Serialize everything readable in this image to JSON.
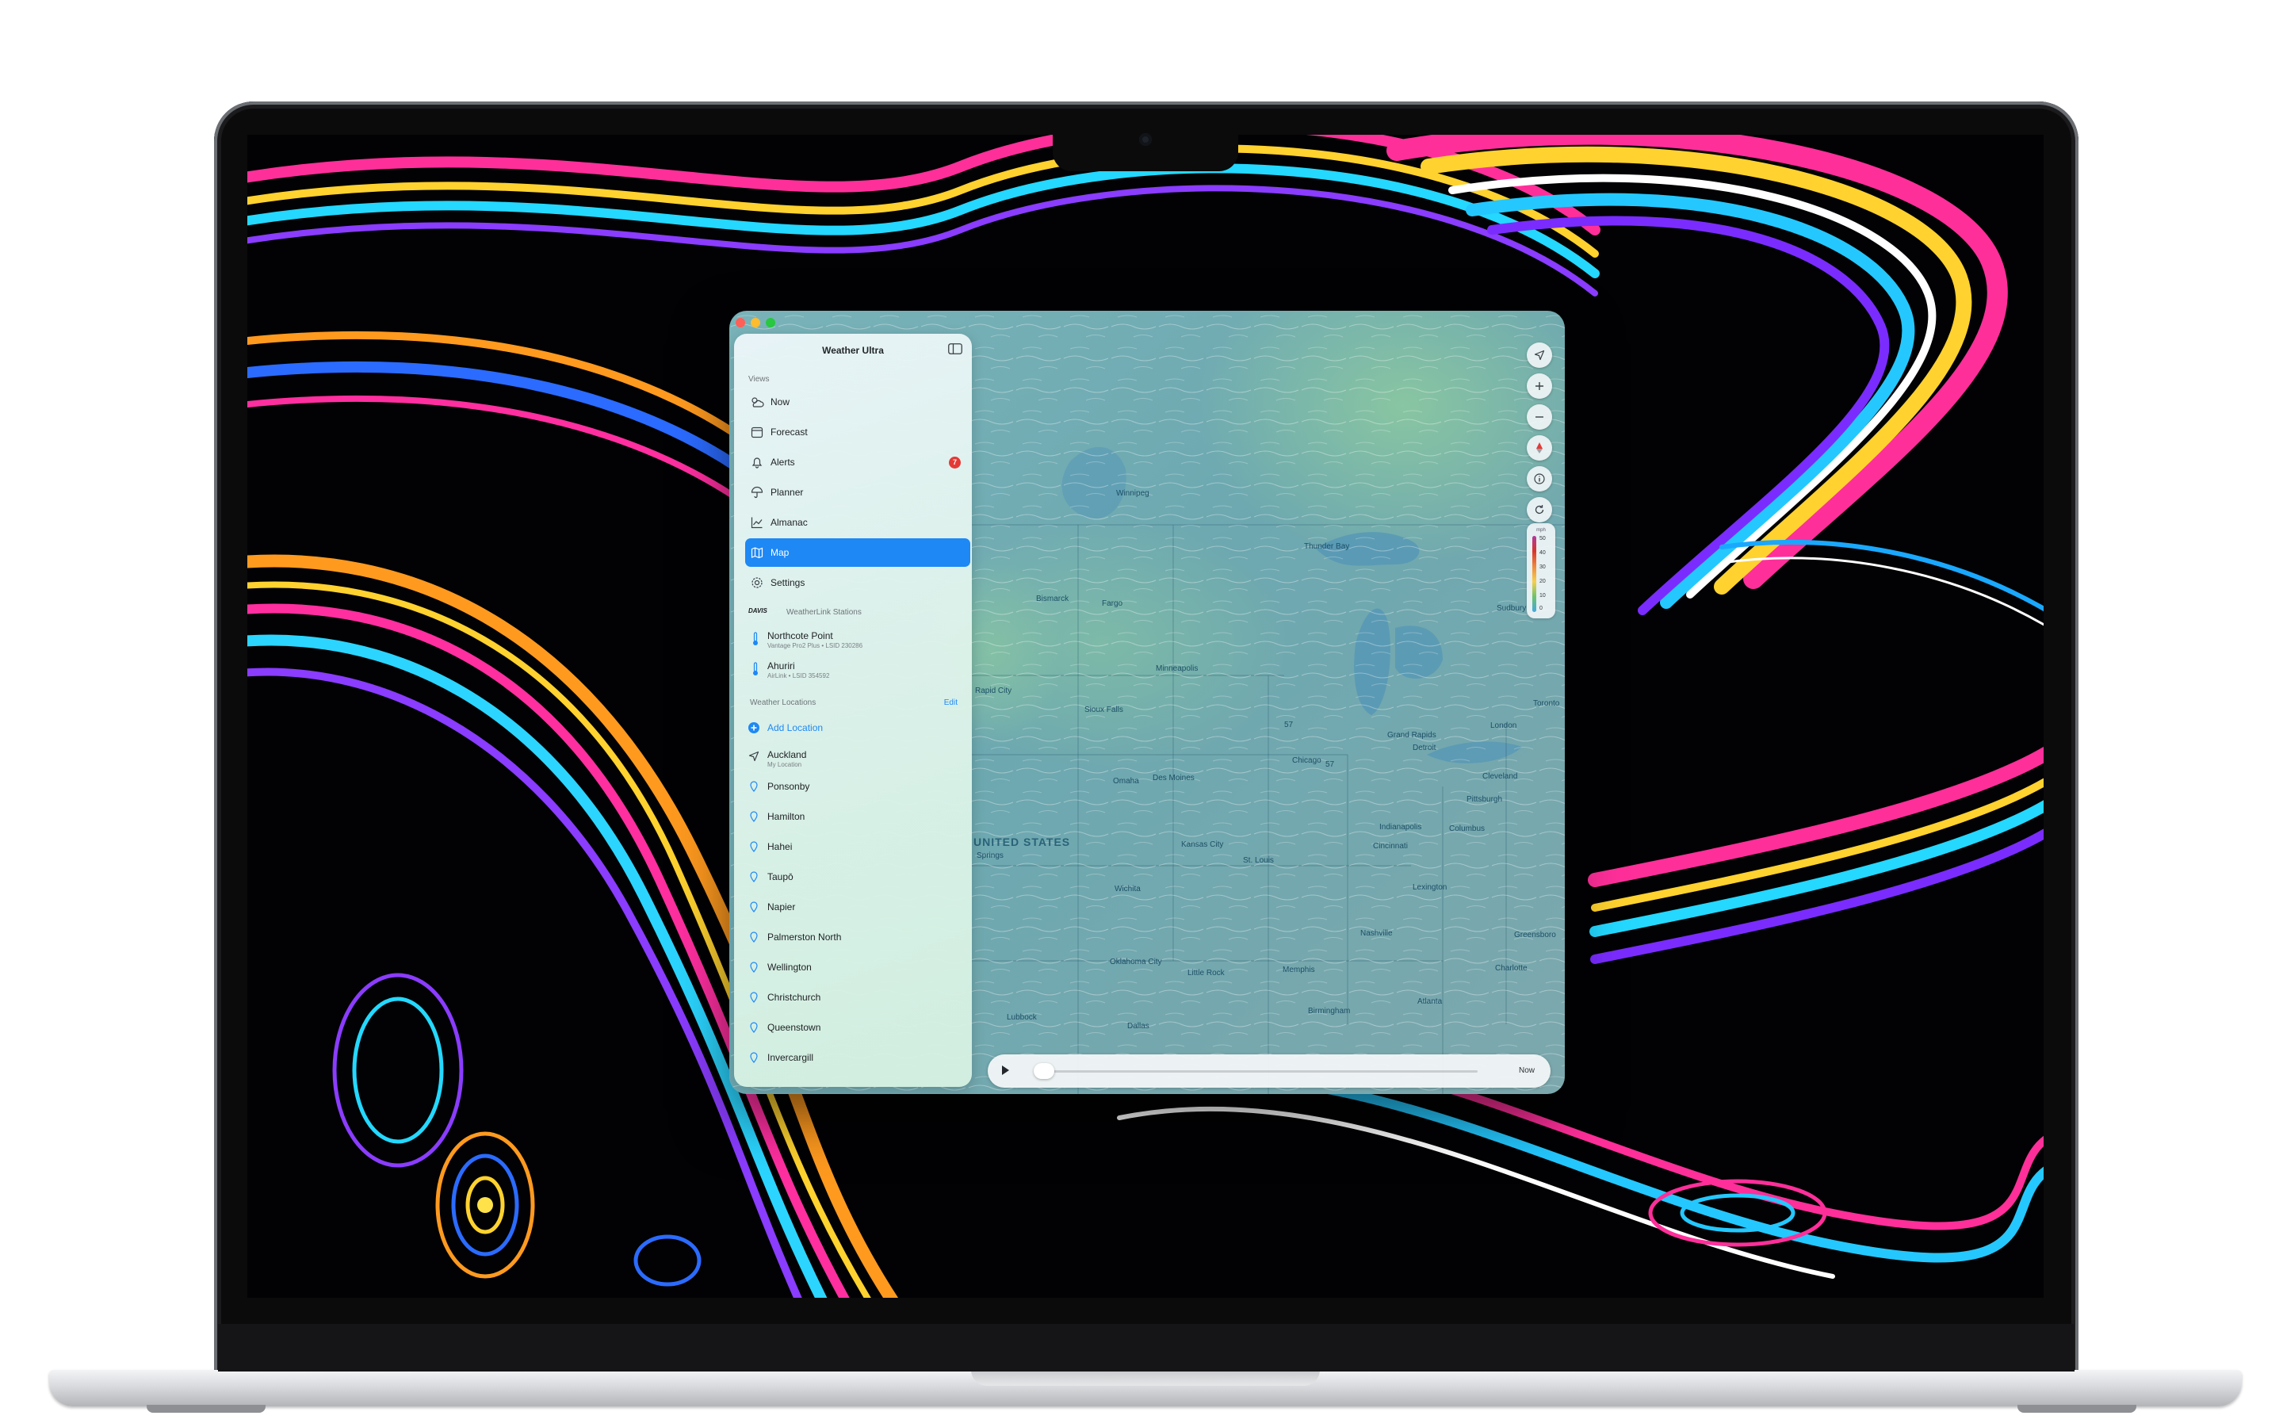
{
  "app": {
    "title": "Weather Ultra"
  },
  "sidebar": {
    "views_heading": "Views",
    "nav": [
      {
        "label": "Now",
        "icon": "sun-cloud-icon"
      },
      {
        "label": "Forecast",
        "icon": "calendar-icon"
      },
      {
        "label": "Alerts",
        "icon": "bell-icon",
        "badge": "7"
      },
      {
        "label": "Planner",
        "icon": "umbrella-icon"
      },
      {
        "label": "Almanac",
        "icon": "chart-icon"
      },
      {
        "label": "Map",
        "icon": "map-icon",
        "selected": true
      },
      {
        "label": "Settings",
        "icon": "gear-icon"
      }
    ],
    "stations_logo": "DAVIS",
    "stations_heading": "WeatherLink Stations",
    "stations": [
      {
        "name": "Northcote Point",
        "detail": "Vantage Pro2 Plus • LSID 230286"
      },
      {
        "name": "Ahuriri",
        "detail": "AirLink • LSID 354592"
      }
    ],
    "locations_heading": "Weather Locations",
    "edit_label": "Edit",
    "add_location_label": "Add Location",
    "locations": [
      {
        "name": "Auckland",
        "detail": "My Location"
      },
      {
        "name": "Ponsonby"
      },
      {
        "name": "Hamilton"
      },
      {
        "name": "Hahei"
      },
      {
        "name": "Taupō"
      },
      {
        "name": "Napier"
      },
      {
        "name": "Palmerston North"
      },
      {
        "name": "Wellington"
      },
      {
        "name": "Christchurch"
      },
      {
        "name": "Queenstown"
      },
      {
        "name": "Invercargill"
      }
    ]
  },
  "map": {
    "legend": {
      "unit": "mph",
      "ticks": [
        "50",
        "40",
        "30",
        "20",
        "10",
        "0"
      ],
      "colors": [
        "#b03a9c",
        "#d9332a",
        "#f0883b",
        "#f6d04a",
        "#6cc36a",
        "#42a8e3"
      ]
    },
    "cities": [
      "Winnipeg",
      "Thunder Bay",
      "Bismarck",
      "Fargo",
      "Sudbury",
      "Minneapolis",
      "Rapid City",
      "Sioux Falls",
      "Toronto",
      "Grand Rapids",
      "Detroit",
      "London",
      "Chicago",
      "Omaha",
      "Des Moines",
      "Cleveland",
      "UNITED STATES",
      "Columbus",
      "Kansas City",
      "Indianapolis",
      "St. Louis",
      "Cincinnati",
      "Wichita",
      "Lexington",
      "Nashville",
      "Oklahoma City",
      "Memphis",
      "Little Rock",
      "Charlotte",
      "Birmingham",
      "Atlanta",
      "Dallas",
      "Lubbock",
      "Greensboro",
      "Springs",
      "Pittsburgh"
    ],
    "wind_labels": [
      "57",
      "57"
    ],
    "now_label": "Now"
  },
  "colors": {
    "accent": "#1e88f5",
    "badge": "#e53935"
  }
}
